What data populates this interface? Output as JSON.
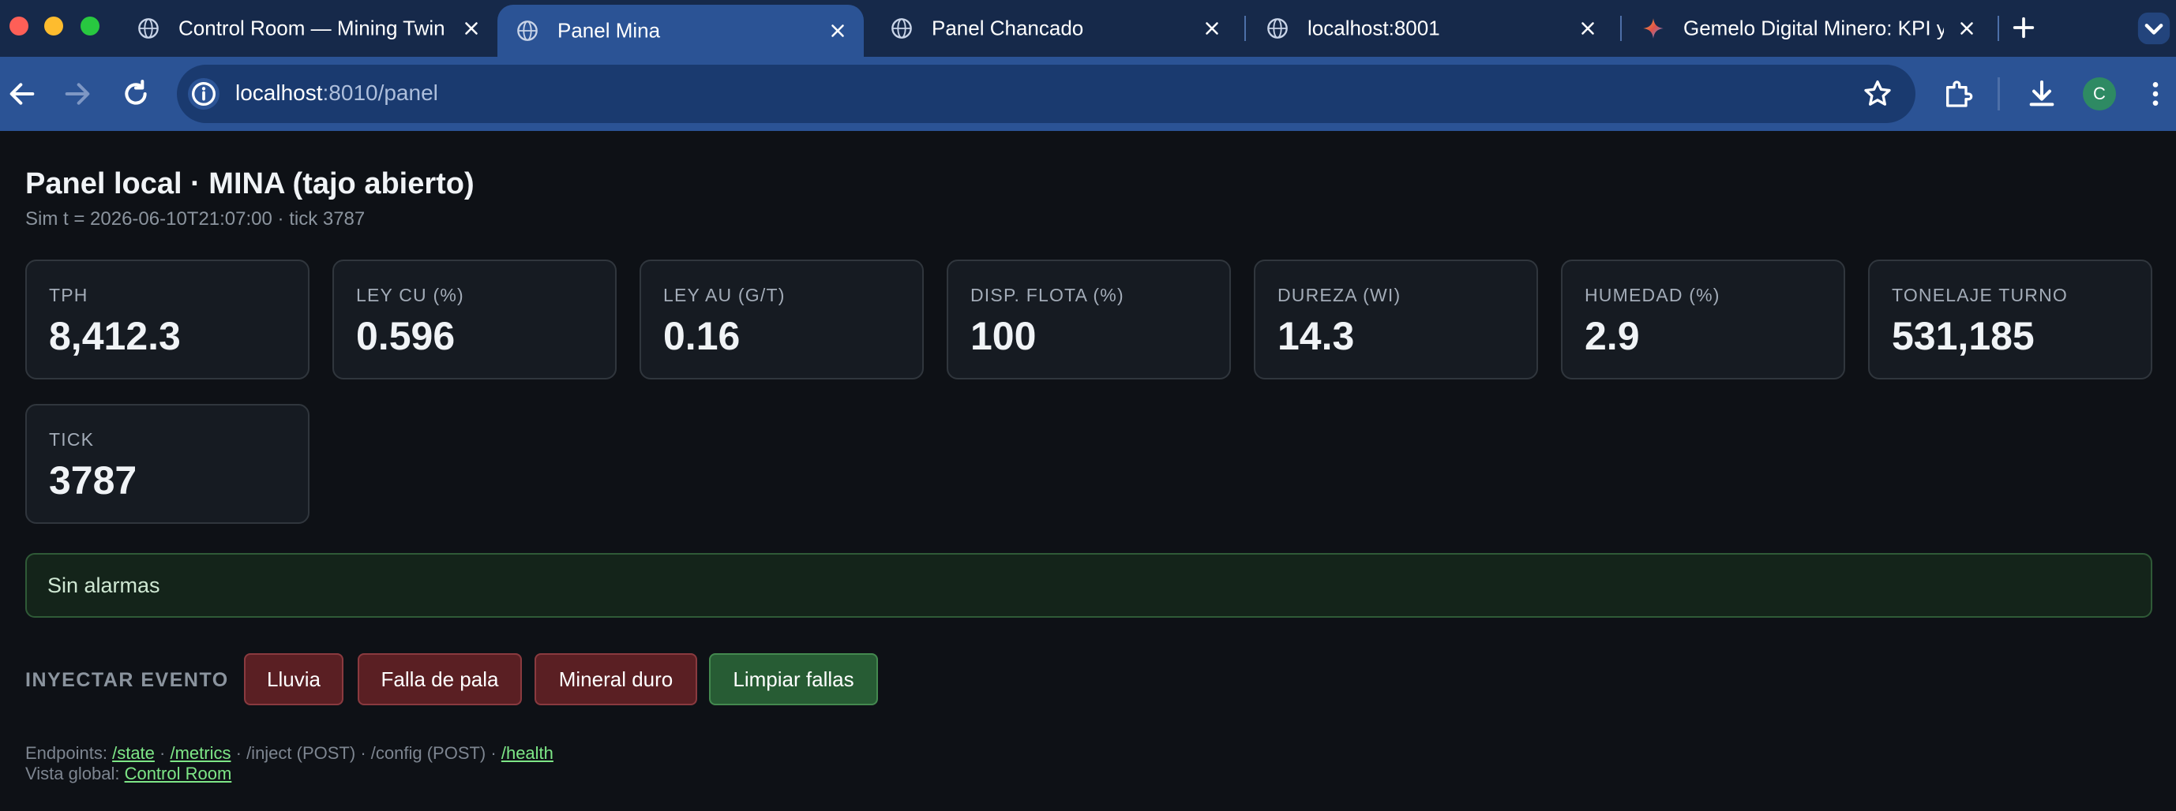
{
  "browser": {
    "tabs": [
      {
        "title": "Control Room — Mining Twin",
        "icon": "globe-icon",
        "active": false
      },
      {
        "title": "Panel Mina",
        "icon": "globe-icon",
        "active": true
      },
      {
        "title": "Panel Chancado",
        "icon": "globe-icon",
        "active": false
      },
      {
        "title": "localhost:8001",
        "icon": "globe-icon",
        "active": false
      },
      {
        "title": "Gemelo Digital Minero: KPI y D",
        "icon": "gemini-sparkle-icon",
        "active": false
      }
    ],
    "url_host": "localhost",
    "url_rest": ":8010/panel",
    "profile_initial": "C"
  },
  "page": {
    "title": "Panel local · MINA (tajo abierto)",
    "subtitle": "Sim t = 2026-06-10T21:07:00 · tick 3787"
  },
  "kpis": [
    {
      "label": "TPH",
      "value": "8,412.3"
    },
    {
      "label": "LEY CU (%)",
      "value": "0.596"
    },
    {
      "label": "LEY AU (G/T)",
      "value": "0.16"
    },
    {
      "label": "DISP. FLOTA (%)",
      "value": "100"
    },
    {
      "label": "DUREZA (WI)",
      "value": "14.3"
    },
    {
      "label": "HUMEDAD (%)",
      "value": "2.9"
    },
    {
      "label": "TONELAJE TURNO",
      "value": "531,185"
    },
    {
      "label": "TICK",
      "value": "3787"
    }
  ],
  "alarm": {
    "text": "Sin alarmas"
  },
  "inject": {
    "label": "INYECTAR EVENTO",
    "buttons": [
      {
        "label": "Lluvia"
      },
      {
        "label": "Falla de pala"
      },
      {
        "label": "Mineral duro"
      },
      {
        "label": "Limpiar fallas"
      }
    ]
  },
  "footer": {
    "endpoints_prefix": "Endpoints:",
    "links": {
      "state": "/state",
      "metrics": "/metrics",
      "health": "/health"
    },
    "inject_text": "/inject (POST)",
    "config_text": "/config (POST)",
    "sep": "·",
    "global_prefix": "Vista global:",
    "global_link": "Control Room"
  },
  "colors": {
    "tabbar": "#16294a",
    "toolbar": "#2b5395",
    "page_bg": "#0e1116",
    "card_bg": "#161b22",
    "alarm_ok": "#14241a",
    "danger_button": "#5a1f23",
    "success_button": "#275c34",
    "link": "#7ee787"
  }
}
